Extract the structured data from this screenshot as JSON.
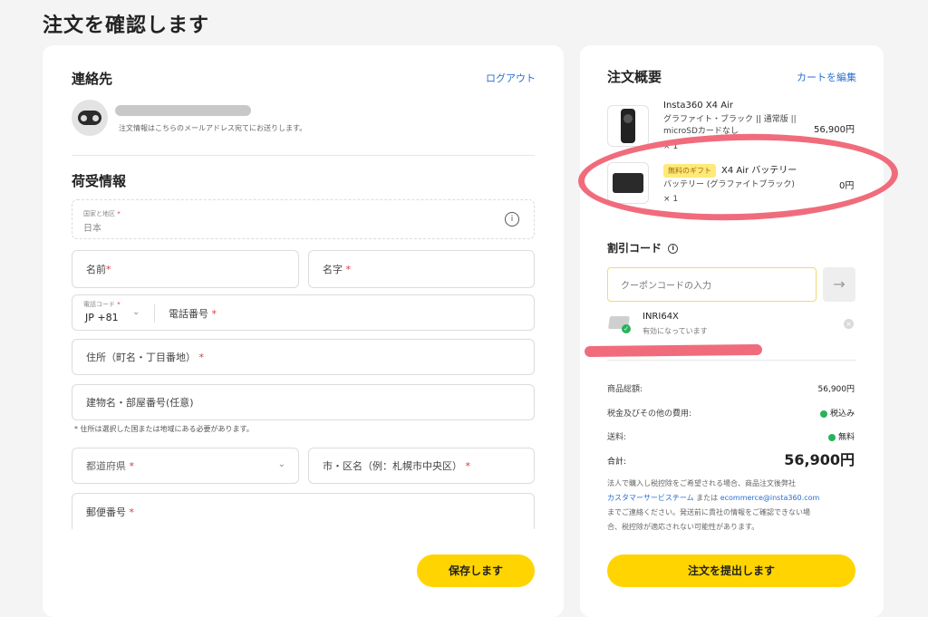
{
  "page": {
    "title": "注文を確認します"
  },
  "contact": {
    "title": "連絡先",
    "logout": "ログアウト",
    "email_note": "注文情報はこちらのメールアドレス宛てにお送りします。"
  },
  "shipping": {
    "title": "荷受情報",
    "country_label": "国家と地区",
    "country_value": "日本",
    "first_name": "名前",
    "last_name": "名字",
    "phone_code_label": "電話コード",
    "phone_code_value": "JP +81",
    "phone_number": "電話番号",
    "address": "住所（町名・丁目番地）",
    "building": "建物名・部屋番号(任意)",
    "country_note": "* 住所は選択した国または地域にある必要があります。",
    "prefecture": "都道府県",
    "city": "市・区名（例：札幌市中央区）",
    "postal": "郵便番号",
    "required_mark": "*",
    "save_button": "保存します"
  },
  "summary": {
    "title": "注文概要",
    "edit_cart": "カートを編集",
    "items": [
      {
        "name": "Insta360 X4 Air",
        "variant": "グラファイト・ブラック || 通常版 || microSDカードなし",
        "qty": "× 1",
        "price": "56,900円"
      },
      {
        "badge": "無料のギフト",
        "name": "X4 Air バッテリー",
        "variant": "バッテリー (グラファイトブラック)",
        "qty": "× 1",
        "price": "0円"
      }
    ],
    "discount_title": "割引コード",
    "coupon_placeholder": "クーポンコードの入力",
    "coupon_code": "INRI64X",
    "coupon_status": "有効になっています",
    "subtotal_label": "商品総額:",
    "subtotal_value": "56,900円",
    "tax_label": "税金及びその他の費用:",
    "tax_value": "税込み",
    "shipping_label": "送料:",
    "shipping_value": "無料",
    "total_label": "合計:",
    "total_value": "56,900円",
    "note_line1": "法人で購入し税控除をご希望される場合、商品注文後弊社",
    "note_link1": "カスタマーサービスチーム",
    "note_mid": " または ",
    "note_link2": "ecommerce@insta360.com",
    "note_line3": "までご連絡ください。発送前に貴社の情報をご確認できない場",
    "note_line4": "合、税控除が適応されない可能性があります。",
    "submit_button": "注文を提出します"
  },
  "colors": {
    "accent_yellow": "#ffd400",
    "link_blue": "#2a6fd1",
    "annotation_pink": "#f06c7c",
    "success_green": "#27b35a"
  }
}
